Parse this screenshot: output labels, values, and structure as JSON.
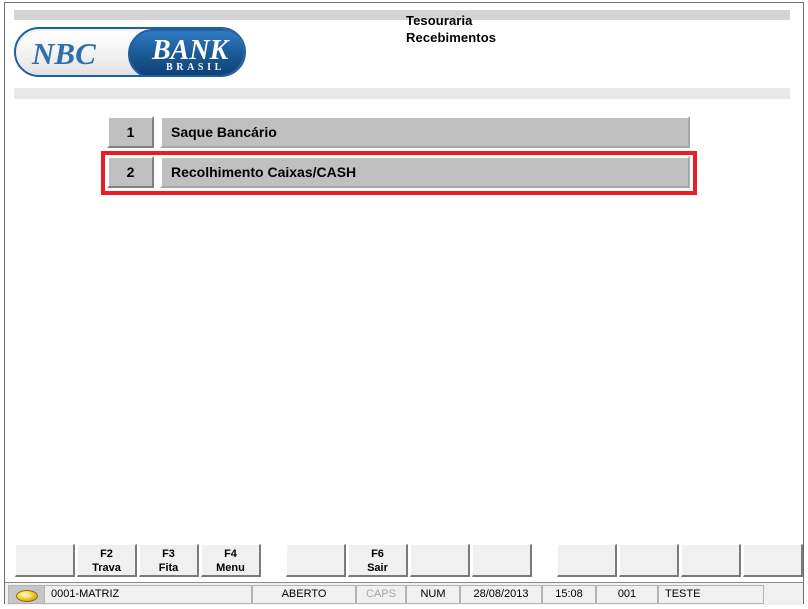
{
  "window": {
    "logo": {
      "primary_text": "NBC",
      "secondary_text": "BANK",
      "tagline": "BRASIL",
      "accent_color": "#1d5c99",
      "text_color": "#2f6fae"
    },
    "header": {
      "title_line1": "Tesouraria",
      "title_line2": "Recebimentos"
    }
  },
  "menu": {
    "items": [
      {
        "number": "1",
        "label": "Saque Bancário",
        "selected": false
      },
      {
        "number": "2",
        "label": "Recolhimento Caixas/CASH",
        "selected": true
      }
    ],
    "selection_color": "#ed1c24"
  },
  "function_keys": [
    {
      "key": "",
      "label": ""
    },
    {
      "key": "F2",
      "label": "Trava"
    },
    {
      "key": "F3",
      "label": "Fita"
    },
    {
      "key": "F4",
      "label": "Menu"
    },
    {
      "key": "",
      "label": ""
    },
    {
      "key": "F6",
      "label": "Sair"
    },
    {
      "key": "",
      "label": ""
    },
    {
      "key": "",
      "label": ""
    },
    {
      "key": "",
      "label": ""
    },
    {
      "key": "",
      "label": ""
    },
    {
      "key": "",
      "label": ""
    },
    {
      "key": "",
      "label": ""
    }
  ],
  "status_bar": {
    "branch": "0001-MATRIZ",
    "state": "ABERTO",
    "caps": "CAPS",
    "num": "NUM",
    "date": "28/08/2013",
    "time": "15:08",
    "terminal": "001",
    "user": "TESTE",
    "coin_icon": "coin-icon"
  }
}
